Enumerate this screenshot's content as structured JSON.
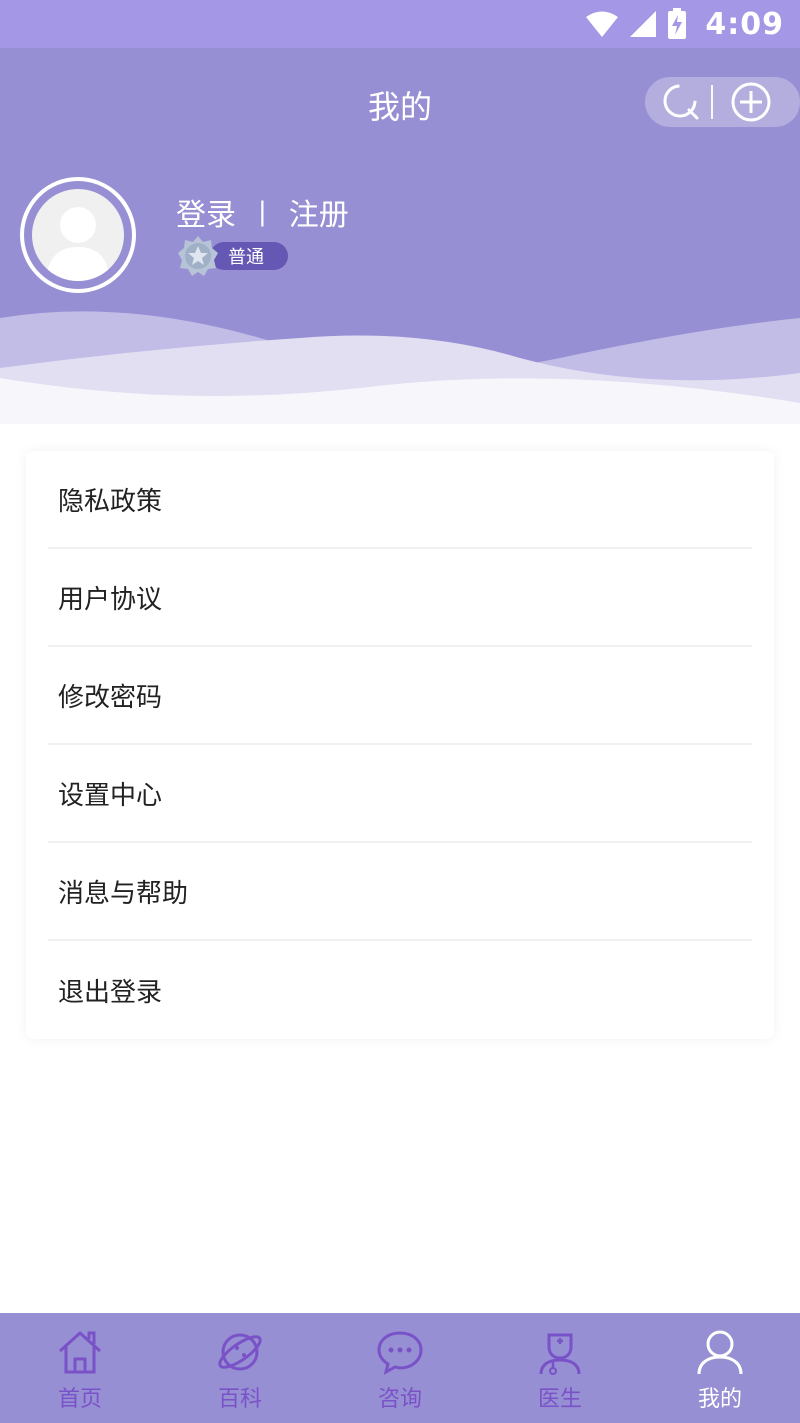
{
  "status_bar": {
    "time": "4:09"
  },
  "header": {
    "title": "我的"
  },
  "profile": {
    "login_label": "登录",
    "separator": "|",
    "register_label": "注册",
    "level_label": "普通"
  },
  "menu": {
    "items": [
      {
        "label": "隐私政策"
      },
      {
        "label": "用户协议"
      },
      {
        "label": "修改密码"
      },
      {
        "label": "设置中心"
      },
      {
        "label": "消息与帮助"
      },
      {
        "label": "退出登录"
      }
    ]
  },
  "tabbar": {
    "tabs": [
      {
        "label": "首页",
        "icon": "home-icon"
      },
      {
        "label": "百科",
        "icon": "planet-icon"
      },
      {
        "label": "咨询",
        "icon": "chat-icon"
      },
      {
        "label": "医生",
        "icon": "doctor-icon"
      },
      {
        "label": "我的",
        "icon": "user-icon",
        "active": true
      }
    ]
  },
  "colors": {
    "header_bg": "#978fd3",
    "status_bg": "#a497e6",
    "badge_bg": "#6557b4",
    "tab_inactive": "#7a52c8",
    "tab_active": "#ffffff"
  }
}
